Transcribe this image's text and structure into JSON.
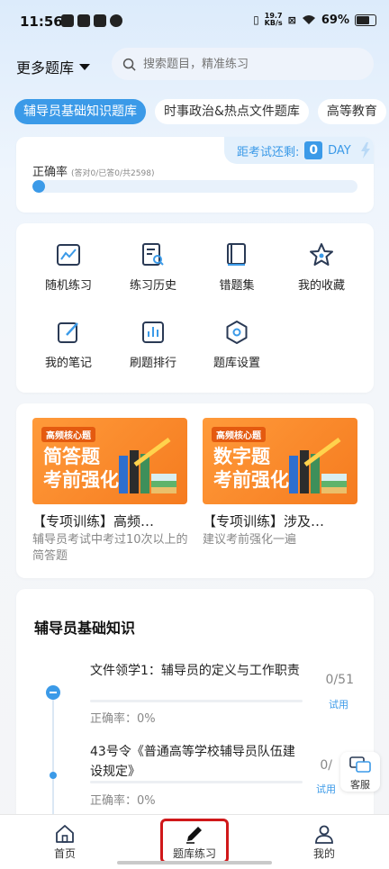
{
  "status_bar": {
    "time": "11:56",
    "net_speed_value": "19.7",
    "net_speed_unit": "KB/s",
    "battery": "69%"
  },
  "header": {
    "bank_select": "更多题库",
    "search_placeholder": "搜索题目，精准练习"
  },
  "chips": [
    "辅导员基础知识题库",
    "时事政治&热点文件题库",
    "高等教育"
  ],
  "accuracy": {
    "exam_countdown_label": "距考试还剩:",
    "days": "0",
    "day_unit": "DAY",
    "label": "正确率",
    "sub": "(答对0/已答0/共2598)",
    "progress": 0
  },
  "features": [
    {
      "label": "随机练习",
      "icon": "chart-icon"
    },
    {
      "label": "练习历史",
      "icon": "history-icon"
    },
    {
      "label": "错题集",
      "icon": "book-icon"
    },
    {
      "label": "我的收藏",
      "icon": "star-icon"
    },
    {
      "label": "我的笔记",
      "icon": "note-icon"
    },
    {
      "label": "刷题排行",
      "icon": "ranking-icon"
    },
    {
      "label": "题库设置",
      "icon": "gear-icon"
    }
  ],
  "special": [
    {
      "tag": "高频核心题",
      "big1": "简答题",
      "big2": "考前强化",
      "title": "【专项训练】高频…",
      "desc": "辅导员考试中考过10次以上的简答题"
    },
    {
      "tag": "高频核心题",
      "big1": "数字题",
      "big2": "考前强化",
      "title": "【专项训练】涉及…",
      "desc": "建议考前强化一遍"
    }
  ],
  "knowledge": {
    "title": "辅导员基础知识",
    "items": [
      {
        "title": "文件领学1：辅导员的定义与工作职责",
        "accuracy": "正确率：0%",
        "count": "0/51",
        "trial": "试用"
      },
      {
        "title": "43号令《普通高等学校辅导员队伍建设规定》",
        "accuracy": "正确率：0%",
        "count": "0/",
        "trial": "试用"
      }
    ]
  },
  "customer_service": "客服",
  "nav": [
    "首页",
    "题库练习",
    "我的"
  ],
  "colors": {
    "accent": "#3b9ae8",
    "banner": "#f57b1f",
    "highlight": "#d0181a"
  }
}
